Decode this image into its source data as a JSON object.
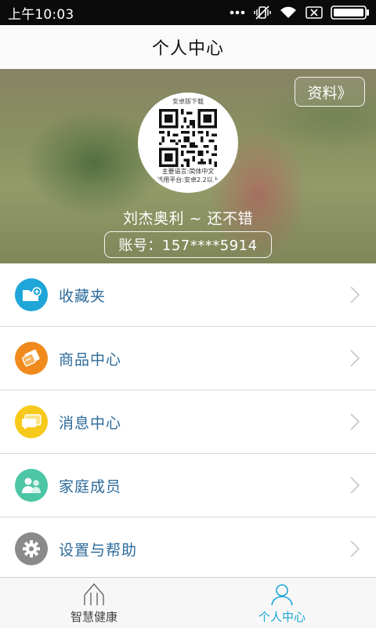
{
  "status_bar": {
    "time": "上午10:03"
  },
  "header": {
    "title": "个人中心"
  },
  "profile": {
    "details_button": "资料》",
    "qr_caption_top": "安卓版下载",
    "qr_line_1": "主要语言:简体中文",
    "qr_line_2": "适用平台:安卓2.2以上",
    "name": "刘杰奥利 ~ 还不错",
    "account": "账号：157****5914"
  },
  "menu": {
    "items": [
      {
        "label": "收藏夹",
        "icon": "folder-plus-icon",
        "color": "#1fa6d8"
      },
      {
        "label": "商品中心",
        "icon": "tag-icon",
        "color": "#f08a1c"
      },
      {
        "label": "消息中心",
        "icon": "chat-bubble-icon",
        "color": "#f7c91a"
      },
      {
        "label": "家庭成员",
        "icon": "family-icon",
        "color": "#4cc6a4"
      },
      {
        "label": "设置与帮助",
        "icon": "gear-icon",
        "color": "#8a8a8a"
      }
    ]
  },
  "bottom_nav": {
    "tabs": [
      {
        "label": "智慧健康",
        "icon": "health-arrow-icon",
        "active": false
      },
      {
        "label": "个人中心",
        "icon": "person-icon",
        "active": true
      }
    ],
    "active_color": "#1aa7d6"
  }
}
